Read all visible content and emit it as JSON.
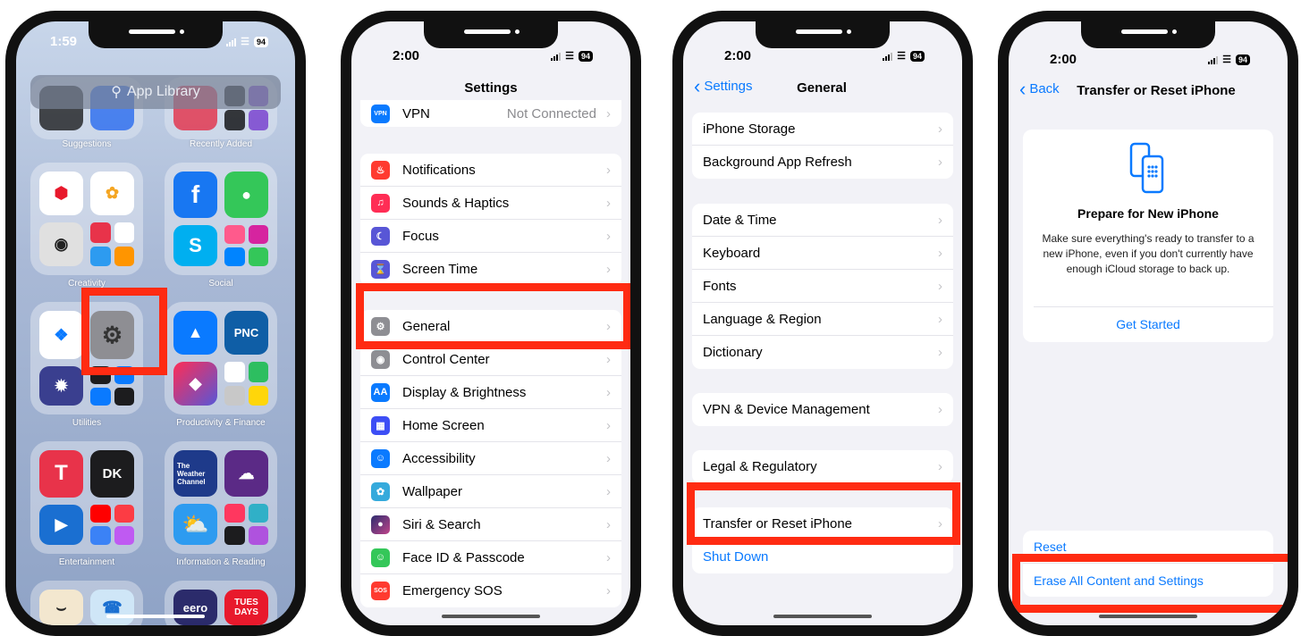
{
  "phone1": {
    "time": "1:59",
    "battery": "94",
    "search_placeholder": "App Library",
    "folder_labels": [
      "Suggestions",
      "Recently Added",
      "Creativity",
      "Social",
      "Utilities",
      "Productivity & Finance",
      "Entertainment",
      "Information & Reading"
    ],
    "app_text": {
      "pnc": "PNC",
      "dk": "DK",
      "weather": "The Weather Channel",
      "eero": "eero",
      "tues": "TUES DAYS"
    }
  },
  "phone2": {
    "time": "2:00",
    "battery": "94",
    "title": "Settings",
    "vpn": {
      "label": "VPN",
      "value": "Not Connected",
      "icon_text": "VPN"
    },
    "group1": [
      {
        "label": "Notifications",
        "color": "#ff3b30",
        "icon": "bell-icon"
      },
      {
        "label": "Sounds & Haptics",
        "color": "#ff2d55",
        "icon": "speaker-icon"
      },
      {
        "label": "Focus",
        "color": "#5856d6",
        "icon": "moon-icon"
      },
      {
        "label": "Screen Time",
        "color": "#5856d6",
        "icon": "hourglass-icon"
      }
    ],
    "group2": [
      {
        "label": "General",
        "color": "#8e8e93",
        "icon": "gear-icon"
      },
      {
        "label": "Control Center",
        "color": "#8e8e93",
        "icon": "toggles-icon"
      },
      {
        "label": "Display & Brightness",
        "color": "#0a7aff",
        "icon": "text-size-icon"
      },
      {
        "label": "Home Screen",
        "color": "#3d4ef5",
        "icon": "grid-icon"
      },
      {
        "label": "Accessibility",
        "color": "#0a7aff",
        "icon": "accessibility-icon"
      },
      {
        "label": "Wallpaper",
        "color": "#35aadc",
        "icon": "flower-icon"
      },
      {
        "label": "Siri & Search",
        "color": "#222244",
        "icon": "siri-icon"
      },
      {
        "label": "Face ID & Passcode",
        "color": "#34c759",
        "icon": "face-id-icon"
      },
      {
        "label": "Emergency SOS",
        "color": "#ff3b30",
        "icon": "sos-icon"
      }
    ],
    "sos_icon_text": "SOS",
    "aa_icon_text": "AA"
  },
  "phone3": {
    "time": "2:00",
    "battery": "94",
    "back_label": "Settings",
    "title": "General",
    "group1": [
      "iPhone Storage",
      "Background App Refresh"
    ],
    "group2": [
      "Date & Time",
      "Keyboard",
      "Fonts",
      "Language & Region",
      "Dictionary"
    ],
    "group3": [
      "VPN & Device Management"
    ],
    "group4": [
      "Legal & Regulatory"
    ],
    "group5": [
      "Transfer or Reset iPhone",
      "Shut Down"
    ]
  },
  "phone4": {
    "time": "2:00",
    "battery": "94",
    "back_label": "Back",
    "title": "Transfer or Reset iPhone",
    "card_title": "Prepare for New iPhone",
    "card_body": "Make sure everything's ready to transfer to a new iPhone, even if you don't currently have enough iCloud storage to back up.",
    "get_started": "Get Started",
    "reset": "Reset",
    "erase": "Erase All Content and Settings"
  },
  "colors": {
    "highlight": "#ff2b12",
    "ios_blue": "#0a7aff"
  }
}
